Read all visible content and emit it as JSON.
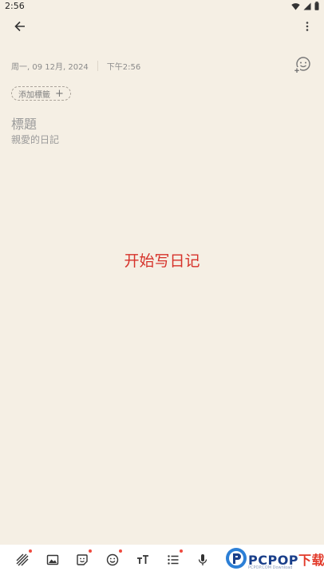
{
  "status_bar": {
    "time": "2:56"
  },
  "entry": {
    "date": "周一, 09 12月, 2024",
    "time": "下午2:56",
    "add_tag_label": "添加標籤",
    "add_tag_plus": "+",
    "title_placeholder": "標題",
    "body_placeholder": "親愛的日記"
  },
  "center_caption": "开始写日记",
  "toolbar": {
    "tools": [
      {
        "icon": "background-icon",
        "badge": true
      },
      {
        "icon": "image-icon",
        "badge": false
      },
      {
        "icon": "sticker-icon",
        "badge": true
      },
      {
        "icon": "emoji-icon",
        "badge": true
      },
      {
        "icon": "text-size-icon",
        "badge": false
      },
      {
        "icon": "list-icon",
        "badge": true
      },
      {
        "icon": "microphone-icon",
        "badge": false
      }
    ]
  },
  "watermark": {
    "brand": "PCPOP",
    "suffix": "下载",
    "sub": "PCPOP.COM Download"
  },
  "colors": {
    "background": "#f5efe4",
    "caption": "#d6322a",
    "badge": "#ef4a3f",
    "toolbar": "#ffffff"
  }
}
